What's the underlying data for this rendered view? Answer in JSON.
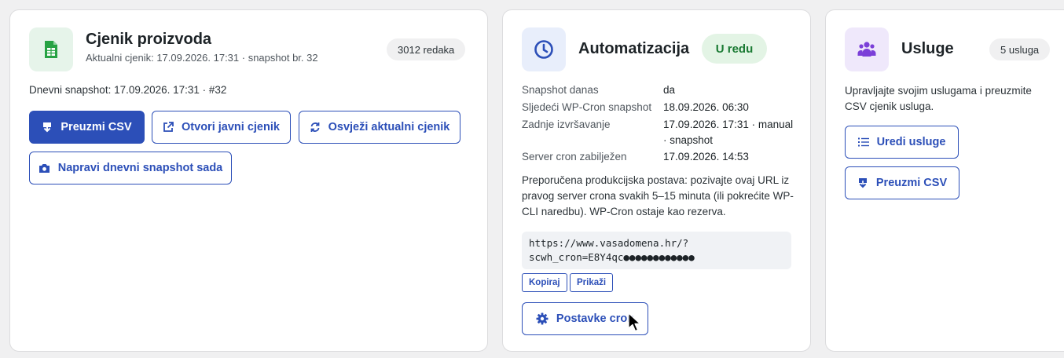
{
  "colors": {
    "accent": "#2c4fb8",
    "ok_bg": "#e3f4e5",
    "ok_text": "#1a7a33",
    "sheet_icon": "#27a244",
    "clock_icon": "#2c4fb8",
    "users_icon": "#7b3fd8"
  },
  "pricelist": {
    "icon": "spreadsheet-icon",
    "title": "Cjenik proizvoda",
    "subtitle": "Aktualni cjenik: 17.09.2026. 17:31 · snapshot br. 32",
    "rows_badge": "3012 redaka",
    "daily_snapshot": "Dnevni snapshot: 17.09.2026. 17:31 · #32",
    "buttons": {
      "download_csv": "Preuzmi CSV",
      "open_public": "Otvori javni cjenik",
      "refresh": "Osvježi aktualni cjenik",
      "make_snapshot": "Napravi dnevni snapshot sada"
    }
  },
  "automation": {
    "icon": "clock-icon",
    "title": "Automatizacija",
    "status": "U redu",
    "rows": [
      {
        "label": "Snapshot danas",
        "value": "da"
      },
      {
        "label": "Sljedeći WP-Cron snapshot",
        "value": "18.09.2026. 06:30"
      },
      {
        "label": "Zadnje izvršavanje",
        "value": "17.09.2026. 17:31 · manual · snapshot"
      },
      {
        "label": "Server cron zabilježen",
        "value": "17.09.2026. 14:53"
      }
    ],
    "recommendation": "Preporučena produkcijska postava: pozivajte ovaj URL iz pravog server crona svakih 5–15 minuta (ili pokrećite WP-CLI naredbu). WP-Cron ostaje kao rezerva.",
    "cron_url": "https://www.vasadomena.hr/?scwh_cron=E8Y4qc●●●●●●●●●●●●",
    "copy_label": "Kopiraj",
    "show_label": "Prikaži",
    "settings_label": "Postavke cron"
  },
  "services": {
    "icon": "users-icon",
    "title": "Usluge",
    "count_badge": "5 usluga",
    "description": "Upravljajte svojim uslugama i preuzmite CSV cjenik usluga.",
    "buttons": {
      "edit": "Uredi usluge",
      "download_csv": "Preuzmi CSV"
    }
  }
}
